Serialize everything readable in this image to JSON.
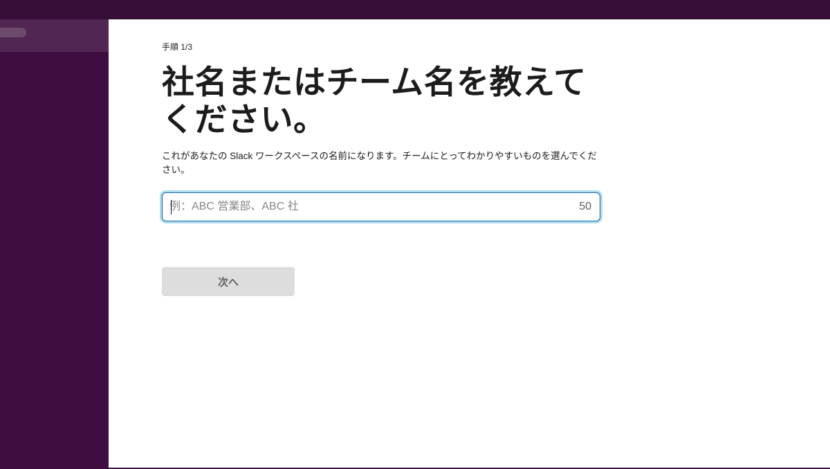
{
  "form": {
    "step": "手順 1/3",
    "title": "社名またはチーム名を教えてください。",
    "description": "これがあなたの Slack ワークスペースの名前になります。チームにとってわかりやすいものを選んでください。",
    "name_input": {
      "value": "",
      "placeholder": "例：ABC 営業部、ABC 社"
    },
    "char_counter": "50",
    "next_label": "次へ"
  },
  "colors": {
    "sidebar": "#3f0e40",
    "topbar": "#350d36",
    "focus_ring": "#1d9bd1",
    "button_disabled_bg": "#dddddd"
  }
}
